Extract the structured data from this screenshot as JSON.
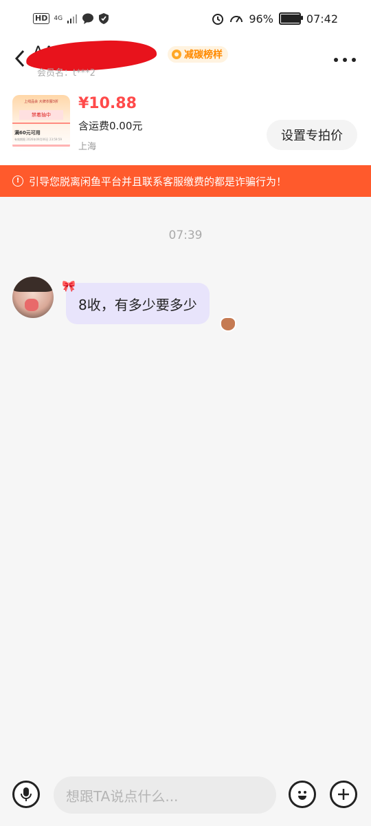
{
  "status_bar": {
    "left_label": "HD",
    "network": "4G",
    "battery_pct": 96,
    "battery_text": "96%",
    "time": "07:42"
  },
  "header": {
    "name": "AA",
    "badge": "减碳榜样",
    "member": "会员名：t***2"
  },
  "product": {
    "thumb_header": "上线品会 大牌衣服3折",
    "thumb_tag": "禁着抽中",
    "thumb_text": "满60元可用",
    "thumb_sub": "有效期限 2026年09月06日 23:59:59",
    "price": "¥10.88",
    "shipping": "含运费0.00元",
    "location": "上海",
    "set_price_label": "设置专拍价"
  },
  "warning": {
    "icon": "!",
    "text": "引导您脱离闲鱼平台并且联系客服缴费的都是诈骗行为！"
  },
  "chat": {
    "timestamp": "07:39",
    "messages": [
      {
        "text": "8收，有多少要多少",
        "decoration": "🎀"
      }
    ]
  },
  "input_bar": {
    "placeholder": "想跟TA说点什么..."
  },
  "icons": {
    "back": "back-icon",
    "more": "more-icon",
    "mic": "mic-icon",
    "emoji": "emoji-icon",
    "plus": "plus-icon"
  },
  "colors": {
    "warning_bg": "#ff5a2c",
    "price": "#ff4a4a",
    "bubble": "#e8e4fb",
    "badge_text": "#ff8a00"
  }
}
